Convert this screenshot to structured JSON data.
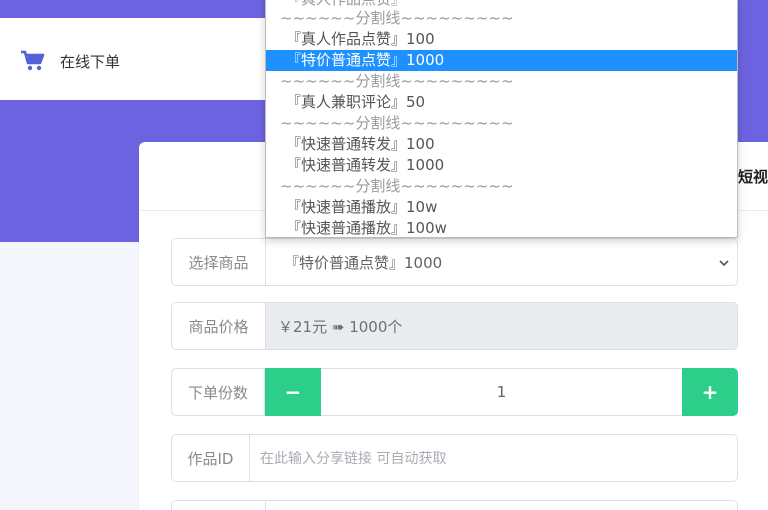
{
  "header": {
    "order_label": "在线下单",
    "cart_icon": "cart-icon"
  },
  "card": {
    "heading_fragment": "短视频"
  },
  "form": {
    "product": {
      "label": "选择商品",
      "value": "『特价普通点赞』1000"
    },
    "price": {
      "label": "商品价格",
      "value": "￥21元 ➠ 1000个"
    },
    "quantity": {
      "label": "下单份数",
      "value": "1",
      "minus": "−",
      "plus": "+"
    },
    "work_id": {
      "label": "作品ID",
      "placeholder": "在此输入分享链接 可自动获取"
    }
  },
  "dropdown": {
    "items": [
      {
        "text": "『真人作品点赞』",
        "type": "partial"
      },
      {
        "text": "~~~~~~分割线~~~~~~~~~",
        "type": "sep"
      },
      {
        "text": "『真人作品点赞』100",
        "type": "option"
      },
      {
        "text": "『特价普通点赞』1000",
        "type": "selected"
      },
      {
        "text": "~~~~~~分割线~~~~~~~~~",
        "type": "sep"
      },
      {
        "text": "『真人兼职评论』50",
        "type": "option"
      },
      {
        "text": "~~~~~~分割线~~~~~~~~~",
        "type": "sep"
      },
      {
        "text": "『快速普通转发』100",
        "type": "option"
      },
      {
        "text": "『快速普通转发』1000",
        "type": "option"
      },
      {
        "text": "~~~~~~分割线~~~~~~~~~",
        "type": "sep"
      },
      {
        "text": "『快速普通播放』10w",
        "type": "option"
      },
      {
        "text": "『快速普通播放』100w",
        "type": "option"
      }
    ]
  },
  "colors": {
    "brand_purple": "#6c63e0",
    "accent_green": "#2dce89",
    "selected_blue": "#1e90ff"
  }
}
